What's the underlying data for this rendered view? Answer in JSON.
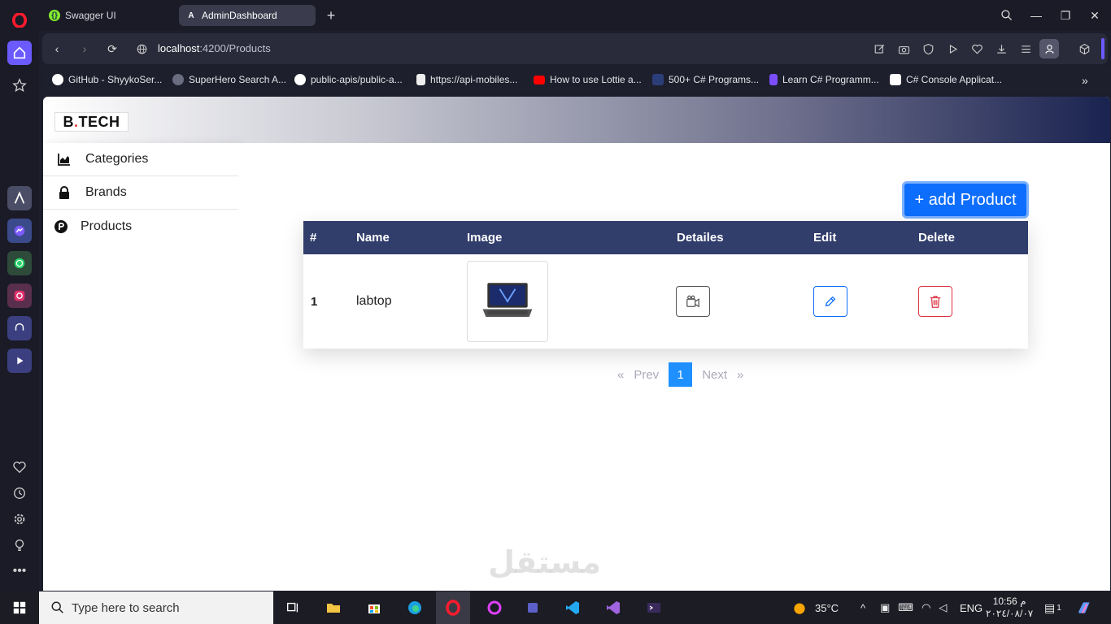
{
  "browser": {
    "tabs": [
      {
        "label": "Swagger UI",
        "active": false
      },
      {
        "label": "AdminDashboard",
        "active": true
      }
    ],
    "url_host": "localhost",
    "url_path": ":4200/Products",
    "bookmarks": [
      "GitHub - ShyykoSer...",
      "SuperHero Search A...",
      "public-apis/public-a...",
      "https://api-mobiles...",
      "How to use Lottie a...",
      "500+ C# Programs...",
      "Learn C# Programm...",
      "C# Console Applicat..."
    ]
  },
  "app": {
    "logo_left": "B",
    "logo_dot": ".",
    "logo_right": "TECH",
    "sidebar": {
      "items": [
        {
          "label": "Categories",
          "icon": "chart-area-icon"
        },
        {
          "label": "Brands",
          "icon": "lock-icon"
        },
        {
          "label": "Products",
          "icon": "product-hunt-icon"
        }
      ]
    },
    "add_button": "+ add Product",
    "table": {
      "headers": [
        "#",
        "Name",
        "Image",
        "Detailes",
        "Edit",
        "Delete"
      ],
      "rows": [
        {
          "index": "1",
          "name": "labtop"
        }
      ]
    },
    "pagination": {
      "prev_arrow": "«",
      "prev": "Prev",
      "current": "1",
      "next": "Next",
      "next_arrow": "»"
    }
  },
  "taskbar": {
    "search_placeholder": "Type here to search",
    "temperature": "35°C",
    "language": "ENG",
    "time": "10:56 م",
    "date": "٢٠٢٤/٠٨/٠٧",
    "notifications": "1"
  },
  "watermark": "مستقل"
}
